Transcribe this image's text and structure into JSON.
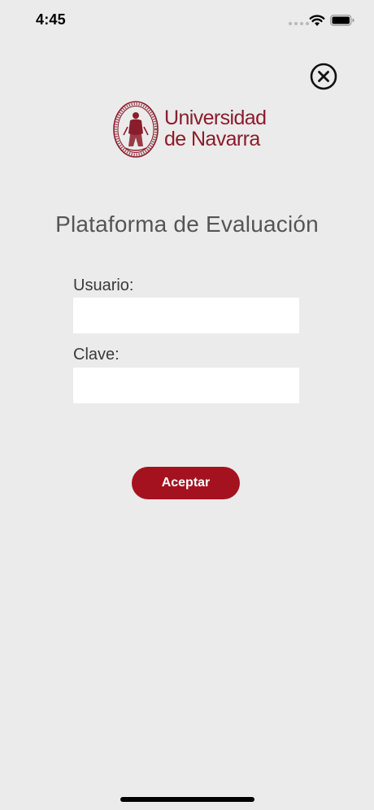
{
  "status_bar": {
    "time": "4:45",
    "wifi_icon": "wifi-icon",
    "battery_icon": "battery-icon"
  },
  "header": {
    "close_icon": "close-icon"
  },
  "logo": {
    "line1": "Universidad",
    "line2": "de Navarra",
    "seal_icon": "university-seal-icon"
  },
  "page": {
    "title": "Plataforma de Evaluación"
  },
  "form": {
    "user_label": "Usuario:",
    "user_value": "",
    "password_label": "Clave:",
    "password_value": "",
    "submit_label": "Aceptar"
  },
  "colors": {
    "background": "#ebebeb",
    "brand": "#8a1d2b",
    "button": "#a5121f",
    "title": "#555555"
  }
}
